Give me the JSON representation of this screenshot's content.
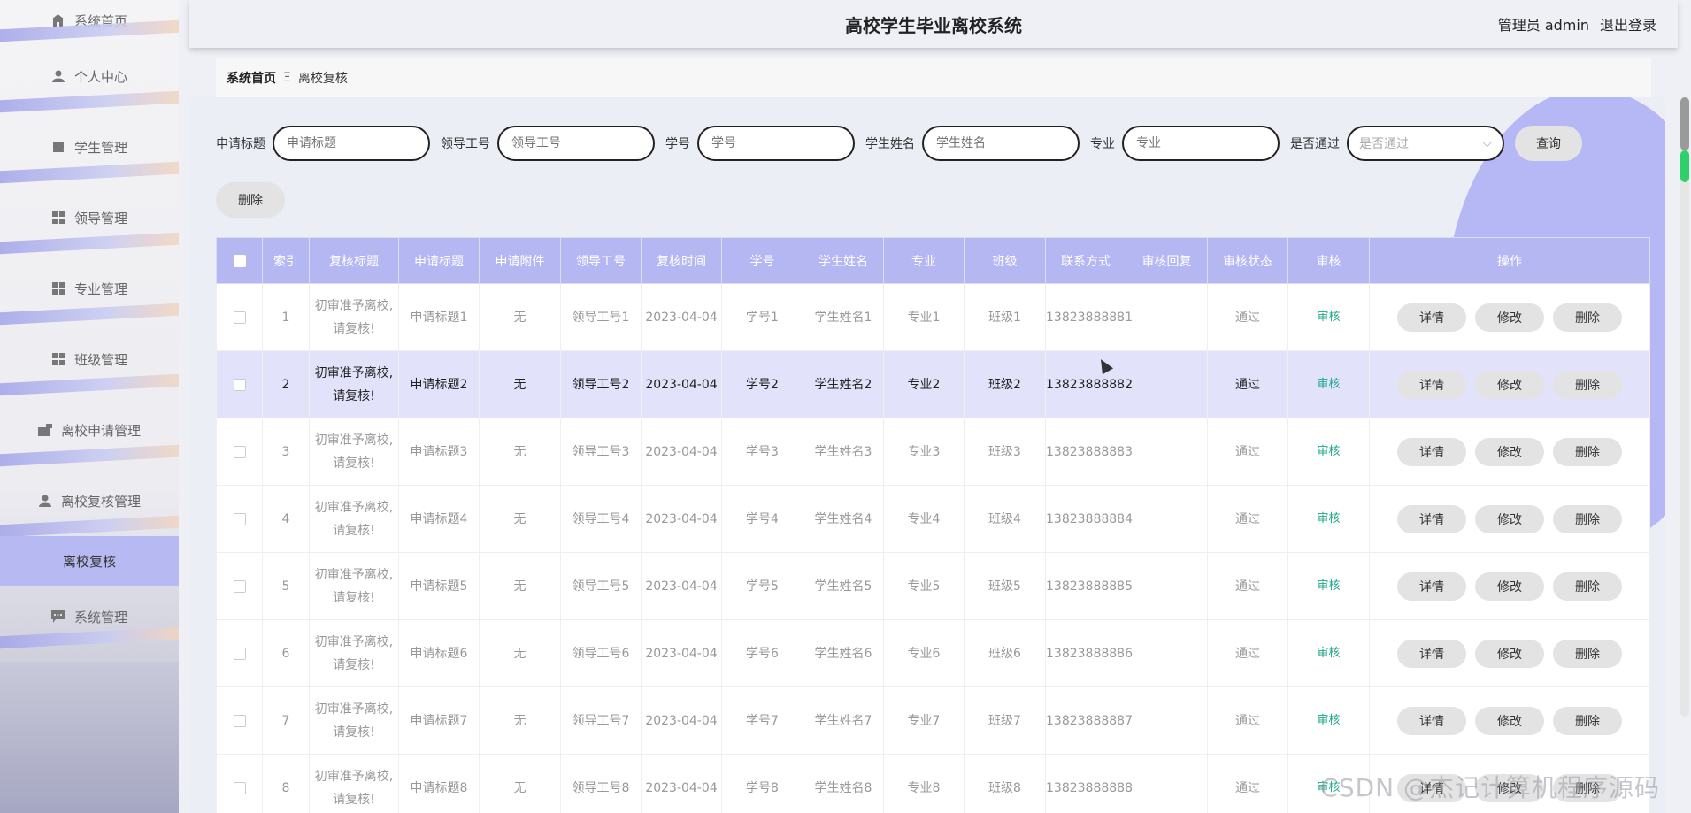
{
  "header": {
    "title": "高校学生毕业离校系统",
    "user": "管理员 admin",
    "logout": "退出登录"
  },
  "sidebar": {
    "items": [
      {
        "label": "系统首页",
        "icon": "home-icon"
      },
      {
        "label": "个人中心",
        "icon": "person-icon"
      },
      {
        "label": "学生管理",
        "icon": "book-icon"
      },
      {
        "label": "领导管理",
        "icon": "grid-icon"
      },
      {
        "label": "专业管理",
        "icon": "grid-icon"
      },
      {
        "label": "班级管理",
        "icon": "grid-icon"
      },
      {
        "label": "离校申请管理",
        "icon": "camera-icon"
      },
      {
        "label": "离校复核管理",
        "icon": "person-icon"
      }
    ],
    "active_sub": "离校复核",
    "last_item": {
      "label": "系统管理",
      "icon": "chat-icon"
    }
  },
  "breadcrumb": {
    "home": "系统首页",
    "sep": "Ξ",
    "current": "离校复核"
  },
  "search": {
    "fields": [
      {
        "label": "申请标题",
        "placeholder": "申请标题"
      },
      {
        "label": "领导工号",
        "placeholder": "领导工号"
      },
      {
        "label": "学号",
        "placeholder": "学号"
      },
      {
        "label": "学生姓名",
        "placeholder": "学生姓名"
      },
      {
        "label": "专业",
        "placeholder": "专业"
      }
    ],
    "select_label": "是否通过",
    "select_placeholder": "是否通过",
    "query_button": "查询",
    "delete_button": "删除"
  },
  "table": {
    "headers": [
      "索引",
      "复核标题",
      "申请标题",
      "申请附件",
      "领导工号",
      "复核时间",
      "学号",
      "学生姓名",
      "专业",
      "班级",
      "联系方式",
      "审核回复",
      "审核状态",
      "审核",
      "操作"
    ],
    "action_labels": {
      "detail": "详情",
      "edit": "修改",
      "delete": "删除"
    },
    "audit_label": "审核",
    "rows": [
      {
        "index": "1",
        "review_title": "初审准予离校,请复核!",
        "apply_title": "申请标题1",
        "attachment": "无",
        "leader_no": "领导工号1",
        "review_time": "2023-04-04",
        "student_no": "学号1",
        "student_name": "学生姓名1",
        "major": "专业1",
        "class": "班级1",
        "contact": "13823888881",
        "reply": "",
        "status": "通过"
      },
      {
        "index": "2",
        "review_title": "初审准予离校,请复核!",
        "apply_title": "申请标题2",
        "attachment": "无",
        "leader_no": "领导工号2",
        "review_time": "2023-04-04",
        "student_no": "学号2",
        "student_name": "学生姓名2",
        "major": "专业2",
        "class": "班级2",
        "contact": "13823888882",
        "reply": "",
        "status": "通过"
      },
      {
        "index": "3",
        "review_title": "初审准予离校,请复核!",
        "apply_title": "申请标题3",
        "attachment": "无",
        "leader_no": "领导工号3",
        "review_time": "2023-04-04",
        "student_no": "学号3",
        "student_name": "学生姓名3",
        "major": "专业3",
        "class": "班级3",
        "contact": "13823888883",
        "reply": "",
        "status": "通过"
      },
      {
        "index": "4",
        "review_title": "初审准予离校,请复核!",
        "apply_title": "申请标题4",
        "attachment": "无",
        "leader_no": "领导工号4",
        "review_time": "2023-04-04",
        "student_no": "学号4",
        "student_name": "学生姓名4",
        "major": "专业4",
        "class": "班级4",
        "contact": "13823888884",
        "reply": "",
        "status": "通过"
      },
      {
        "index": "5",
        "review_title": "初审准予离校,请复核!",
        "apply_title": "申请标题5",
        "attachment": "无",
        "leader_no": "领导工号5",
        "review_time": "2023-04-04",
        "student_no": "学号5",
        "student_name": "学生姓名5",
        "major": "专业5",
        "class": "班级5",
        "contact": "13823888885",
        "reply": "",
        "status": "通过"
      },
      {
        "index": "6",
        "review_title": "初审准予离校,请复核!",
        "apply_title": "申请标题6",
        "attachment": "无",
        "leader_no": "领导工号6",
        "review_time": "2023-04-04",
        "student_no": "学号6",
        "student_name": "学生姓名6",
        "major": "专业6",
        "class": "班级6",
        "contact": "13823888886",
        "reply": "",
        "status": "通过"
      },
      {
        "index": "7",
        "review_title": "初审准予离校,请复核!",
        "apply_title": "申请标题7",
        "attachment": "无",
        "leader_no": "领导工号7",
        "review_time": "2023-04-04",
        "student_no": "学号7",
        "student_name": "学生姓名7",
        "major": "专业7",
        "class": "班级7",
        "contact": "13823888887",
        "reply": "",
        "status": "通过"
      },
      {
        "index": "8",
        "review_title": "初审准予离校,请复核!",
        "apply_title": "申请标题8",
        "attachment": "无",
        "leader_no": "领导工号8",
        "review_time": "2023-04-04",
        "student_no": "学号8",
        "student_name": "学生姓名8",
        "major": "专业8",
        "class": "班级8",
        "contact": "13823888888",
        "reply": "",
        "status": "通过"
      }
    ]
  },
  "watermark": "CSDN @杰记计算机程序源码"
}
